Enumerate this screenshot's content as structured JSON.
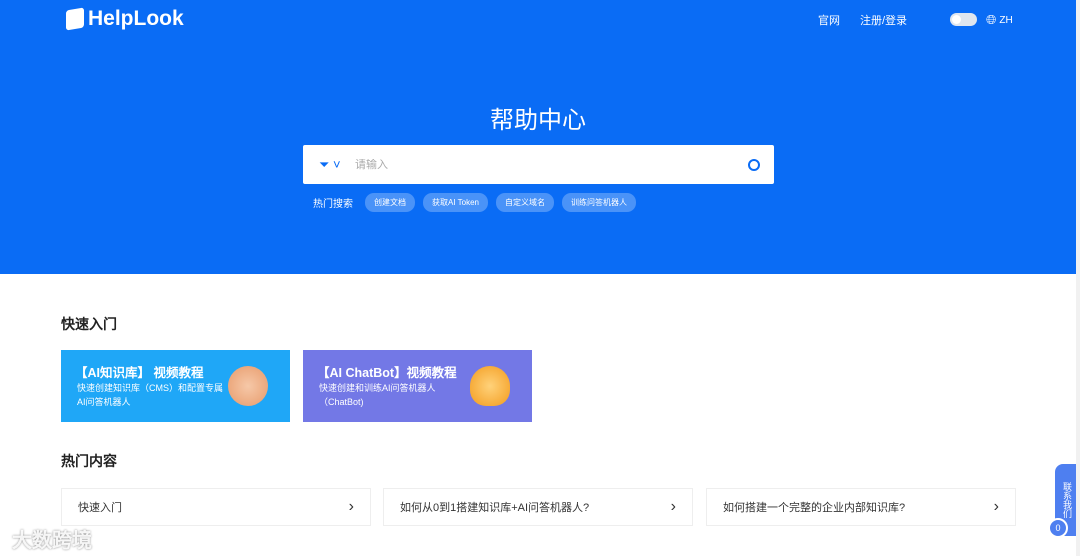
{
  "header": {
    "logo": "HelpLook",
    "nav": [
      "官网",
      "注册/登录"
    ],
    "lang": "ZH"
  },
  "hero": {
    "title": "帮助中心",
    "search_placeholder": "请输入",
    "hot_label": "热门搜索",
    "hot_tags": [
      "创建文档",
      "获取AI Token",
      "自定义域名",
      "训练问答机器人"
    ]
  },
  "quick": {
    "heading": "快速入门",
    "cards": [
      {
        "title": "【AI知识库】 视频教程",
        "desc": "快速创建知识库（CMS）和配置专属AI问答机器人",
        "color": "#1fa7f7"
      },
      {
        "title": "【AI ChatBot】视频教程",
        "desc": "快速创建和训练AI问答机器人（ChatBot)",
        "color": "#7378e6"
      }
    ]
  },
  "hot_content": {
    "heading": "热门内容",
    "items": [
      "快速入门",
      "如何从0到1搭建知识库+AI问答机器人?",
      "如何搭建一个完整的企业内部知识库?"
    ]
  },
  "side": {
    "contact": "联系我们",
    "badge": "0"
  },
  "watermark": "大数跨境"
}
